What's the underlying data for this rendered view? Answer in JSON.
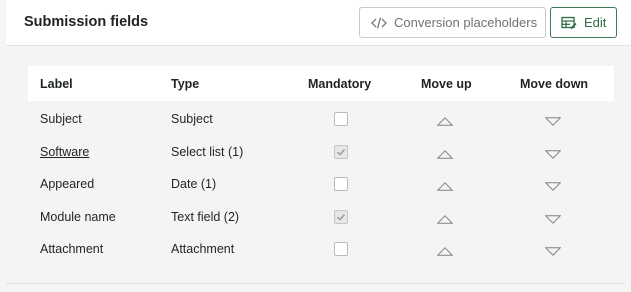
{
  "header": {
    "title": "Submission fields",
    "placeholders_button": "Conversion placeholders",
    "edit_button": "Edit"
  },
  "table": {
    "columns": [
      "Label",
      "Type",
      "Mandatory",
      "Move up",
      "Move down"
    ],
    "rows": [
      {
        "label": "Subject",
        "type": "Subject",
        "mandatory": false,
        "is_link": false
      },
      {
        "label": "Software",
        "type": "Select list (1)",
        "mandatory": true,
        "is_link": true
      },
      {
        "label": "Appeared",
        "type": "Date (1)",
        "mandatory": false,
        "is_link": false
      },
      {
        "label": "Module name",
        "type": "Text field (2)",
        "mandatory": true,
        "is_link": false
      },
      {
        "label": "Attachment",
        "type": "Attachment",
        "mandatory": false,
        "is_link": false
      }
    ]
  },
  "colors": {
    "accent": "#3f7a55",
    "link": "#3d7358"
  },
  "icons": {
    "placeholders": "code-icon",
    "edit": "edit-table-icon",
    "move_up": "triangle-up-icon",
    "move_down": "triangle-down-icon"
  }
}
